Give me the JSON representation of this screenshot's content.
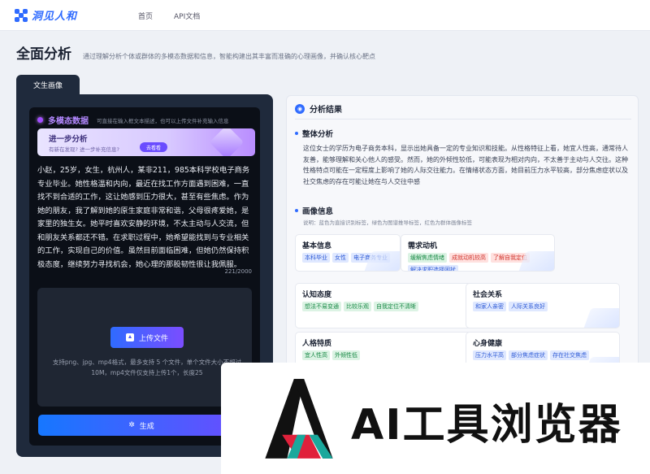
{
  "app": {
    "brand": "洞见人和"
  },
  "nav": {
    "items": [
      "首页",
      "API文档"
    ]
  },
  "page": {
    "title": "全面分析",
    "subtitle": "通过理解分析个体或群体的多模态数据和信息，智能构建出其丰富而准确的心理画像，并确认核心靶点"
  },
  "left": {
    "tab": "文生画像",
    "multimodal": {
      "title": "多模态数据",
      "hint": "可直接在输入框文本描述，也可以上传文件补充输入信息"
    },
    "banner": {
      "title": "进一步分析",
      "subtitle": "有新在发现? 进一步补充信息?",
      "button": "去看看"
    },
    "text": "小赵，25岁，女生，杭州人，某非211，985本科学校电子商务专业毕业。她性格温和内向，最近在找工作方面遇到困难，一直找不到合适的工作，这让她感到压力很大，甚至有些焦虑。作为她的朋友，我了解到她的原生家庭非常和谐，父母很疼爱她，是家里的独生女。她平时喜欢安静的环境，不太主动与人交流，但和朋友关系都还不错。在求职过程中，她希望能找到与专业相关的工作，实现自己的价值。虽然目前面临困难，但她仍然保持积极态度，继续努力寻找机会，她心理的那股韧性很让我佩服。",
    "count": "221/2000",
    "upload": {
      "button": "上传文件",
      "hint": "支持png、jpg、mp4格式，最多支持 5 个文件，单个文件大小不超过10M，mp4文件仅支持上传1个，长度25"
    },
    "generate": "生成"
  },
  "right": {
    "header": "分析结果",
    "overall": {
      "title": "整体分析",
      "text": "这位女士的学历为电子商务本科，显示出她具备一定的专业知识和技能。从性格特征上看，她宜人性高，通常待人友善，能够理解和关心他人的感受。然而，她的外倾性较低，可能表现为相对内向，不太善于主动与人交往。这种性格特点可能在一定程度上影响了她的人际交往能力。在情绪状态方面，她目前压力水平较高，部分焦虑症状以及社交焦虑的存在可能让她在与人交往中感"
    },
    "profile": {
      "title": "画像信息",
      "legend": "说明：蓝色为直接识别标签，绿色为图谱推导标签，红色为群体画像标签"
    },
    "cards": [
      {
        "title": "基本信息",
        "tags": [
          {
            "t": "本科毕业",
            "c": "blue"
          },
          {
            "t": "女性",
            "c": "blue"
          },
          {
            "t": "电子商务专业",
            "c": "blue"
          }
        ]
      },
      {
        "title": "需求动机",
        "tags": [
          {
            "t": "缓解焦虑情绪",
            "c": "green"
          },
          {
            "t": "成就动机较高",
            "c": "red"
          },
          {
            "t": "了解自我定位",
            "c": "red"
          },
          {
            "t": "解决求职选择困扰",
            "c": "blue"
          }
        ]
      },
      {
        "title": "认知态度",
        "tags": [
          {
            "t": "想法不易变通",
            "c": "green"
          },
          {
            "t": "比较乐观",
            "c": "green"
          },
          {
            "t": "自我定位不清晰",
            "c": "green"
          }
        ]
      },
      {
        "title": "社会关系",
        "tags": [
          {
            "t": "和家人亲密",
            "c": "blue"
          },
          {
            "t": "人际关系良好",
            "c": "blue"
          }
        ]
      },
      {
        "title": "人格特质",
        "tags": [
          {
            "t": "宜人性高",
            "c": "green"
          },
          {
            "t": "外倾性低",
            "c": "green"
          }
        ]
      },
      {
        "title": "心身健康",
        "tags": [
          {
            "t": "压力水平高",
            "c": "blue"
          },
          {
            "t": "部分焦虑症状",
            "c": "blue"
          },
          {
            "t": "存在社交焦虑",
            "c": "blue"
          }
        ]
      }
    ]
  },
  "watermark": {
    "text": "AI工具浏览器"
  }
}
